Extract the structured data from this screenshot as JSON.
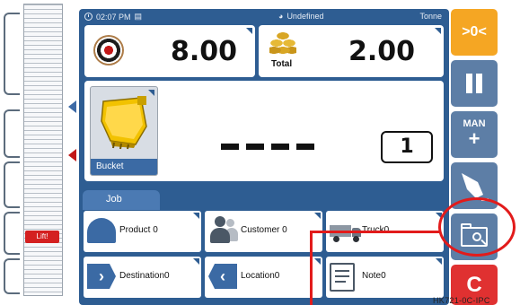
{
  "status_bar": {
    "time": "02:07 PM",
    "mode_icon": "list-icon",
    "product_status": "Undefined",
    "unit": "Tonne"
  },
  "target": {
    "icon": "target-icon",
    "value": "8.00"
  },
  "total": {
    "icon": "coins-icon",
    "label": "Total",
    "value": "2.00"
  },
  "attachment": {
    "label": "Bucket",
    "weight_display": "----",
    "pass_count": "1"
  },
  "left_scale": {
    "lift_label": "Lift!"
  },
  "job": {
    "tab_label": "Job",
    "tiles": [
      {
        "label": "Product 0"
      },
      {
        "label": "Customer 0"
      },
      {
        "label": "Truck0"
      },
      {
        "label": "Destination0"
      },
      {
        "label": "Location0"
      },
      {
        "label": "Note0"
      }
    ]
  },
  "sidebar": {
    "zero_label": ">0<",
    "man_label": "MAN",
    "man_plus": "+",
    "clear_label": "C"
  },
  "annotation": {
    "code": "HK721-0C-IPC"
  },
  "colors": {
    "panel": "#2e5d92",
    "zero_button": "#f5a623",
    "side_button": "#5d7ea6",
    "clear_button": "#e03131",
    "highlight": "#e21b1b"
  }
}
